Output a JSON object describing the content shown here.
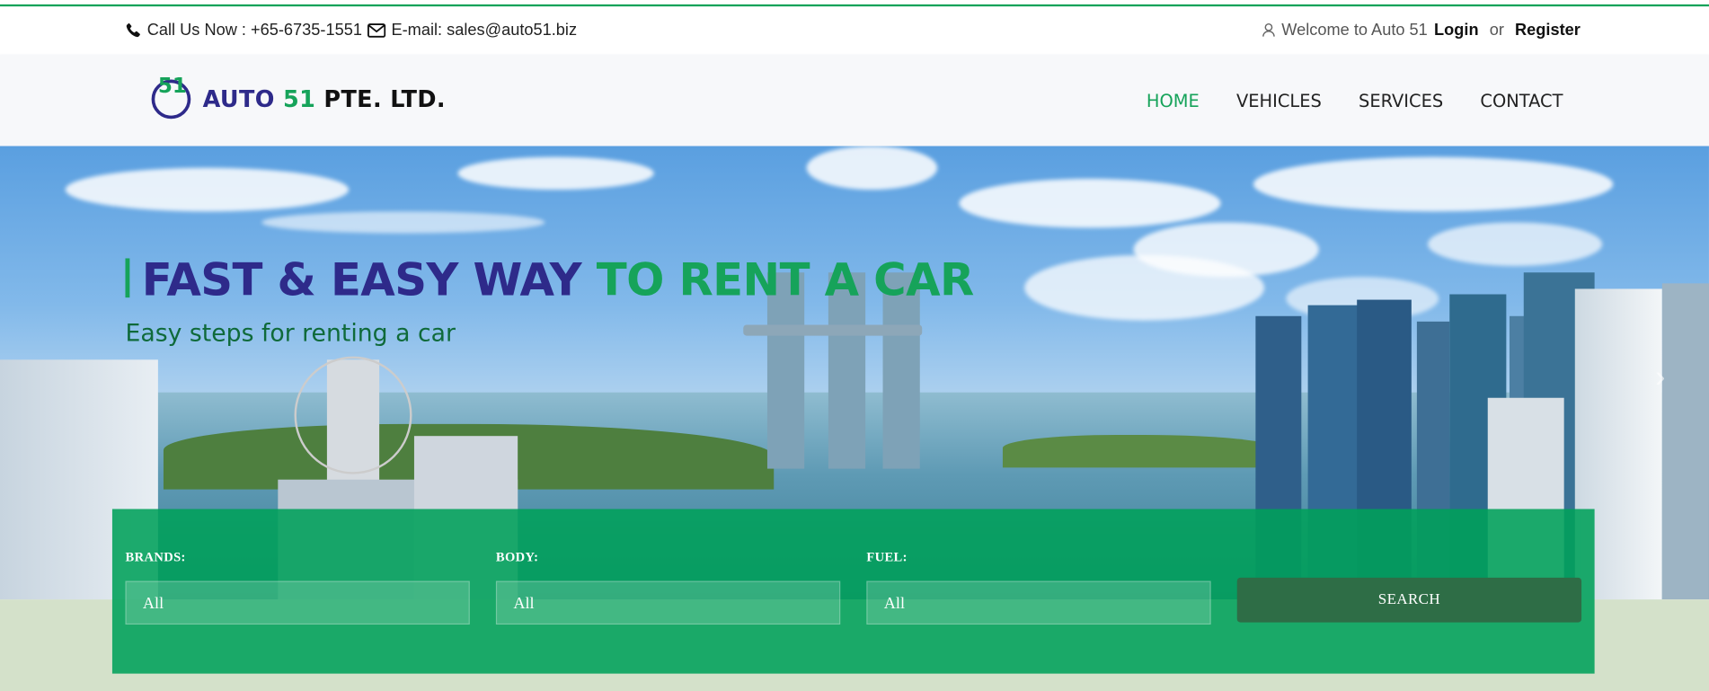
{
  "topbar": {
    "phone_text": "Call Us Now : +65-6735-1551",
    "email_text": "E-mail: sales@auto51.biz",
    "welcome_text": "Welcome to Auto 51",
    "login_label": "Login",
    "or_text": "or",
    "register_label": "Register",
    "phone_icon": "phone-icon",
    "email_icon": "envelope-icon",
    "user_icon": "user-icon"
  },
  "brand": {
    "logo_number": "51",
    "name_part1": "AUTO",
    "name_part2": "51",
    "name_part3": "PTE. LTD.",
    "color_primary": "#2e2a8a",
    "color_accent": "#16a35a"
  },
  "nav": {
    "items": [
      {
        "label": "HOME",
        "active": true
      },
      {
        "label": "VEHICLES",
        "active": false
      },
      {
        "label": "SERVICES",
        "active": false
      },
      {
        "label": "CONTACT",
        "active": false
      }
    ]
  },
  "hero": {
    "title_part1": "FAST & EASY WAY",
    "title_part2": "TO RENT A CAR",
    "subtitle": "Easy steps for renting a car",
    "next_icon": "chevron-right-icon"
  },
  "search": {
    "brands_label": "BRANDS:",
    "brands_value": "All",
    "body_label": "BODY:",
    "body_value": "All",
    "fuel_label": "FUEL:",
    "fuel_value": "All",
    "search_label": "SEARCH"
  }
}
